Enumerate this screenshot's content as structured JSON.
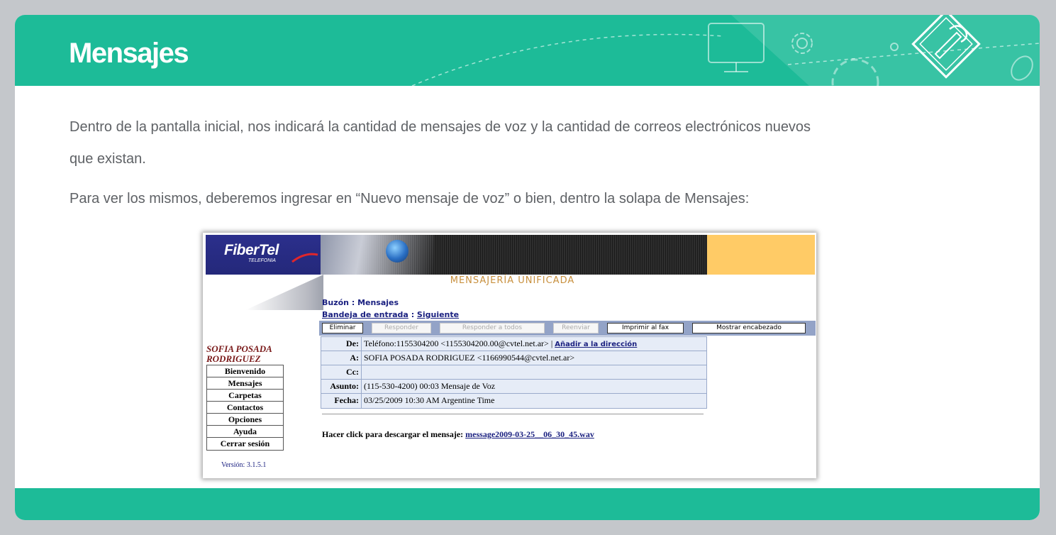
{
  "header": {
    "title": "Mensajes",
    "color": "#1dbb98"
  },
  "body": {
    "paragraph_1_line_1": "Dentro de la pantalla inicial, nos indicará la cantidad de mensajes de voz y la cantidad de correos electrónicos nuevos",
    "paragraph_1_line_2": "que existan.",
    "paragraph_2": "Para ver los mismos, deberemos ingresar en “Nuevo mensaje de voz” o bien, dentro la solapa de Mensajes:"
  },
  "screenshot": {
    "brand": "FiberTel",
    "brand_sub": "TELEFONIA",
    "app_title": "MENSAJERÍA UNIFICADA",
    "buzon": "Buzón : Mensajes",
    "bandeja_label": "Bandeja de entrada",
    "bandeja_sep": " : ",
    "siguiente_label": "Siguiente",
    "toolbar": {
      "eliminar": "Eliminar",
      "responder": "Responder",
      "responder_todos": "Responder a todos",
      "reenviar": "Reenviar",
      "imprimir_fax": "Imprimir al fax",
      "mostrar_encabezado": "Mostrar encabezado"
    },
    "user_name_line_1": "SOFIA POSADA",
    "user_name_line_2": "RODRIGUEZ",
    "nav": {
      "bienvenido": "Bienvenido",
      "mensajes": "Mensajes",
      "carpetas": "Carpetas",
      "contactos": "Contactos",
      "opciones": "Opciones",
      "ayuda": "Ayuda",
      "cerrar_sesion": "Cerrar sesión"
    },
    "version": "Versión: 3.1.5.1",
    "message_header": {
      "de_label": "De:",
      "de_value": "Teléfono:1155304200 <1155304200.00@cvtel.net.ar>",
      "de_pipe": " | ",
      "add_address_label": "Añadir a la dirección",
      "a_label": "A:",
      "a_value": "SOFIA POSADA RODRIGUEZ <1166990544@cvtel.net.ar>",
      "cc_label": "Cc:",
      "cc_value": "",
      "asunto_label": "Asunto:",
      "asunto_value": "(115-530-4200) 00:03 Mensaje de Voz",
      "fecha_label": "Fecha:",
      "fecha_value": "03/25/2009 10:30 AM Argentine Time"
    },
    "download_text": "Hacer click para descargar el mensaje: ",
    "download_link": "message2009-03-25__06_30_45.wav"
  }
}
